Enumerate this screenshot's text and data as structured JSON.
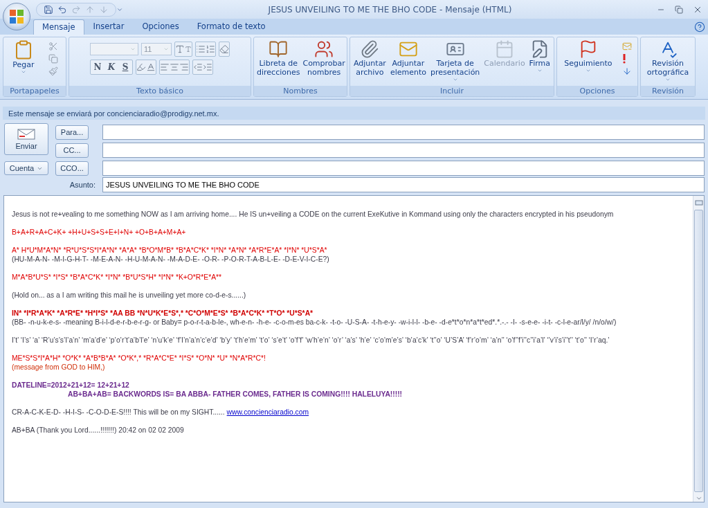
{
  "window": {
    "title": "JESUS UNVEILING TO ME THE BHO CODE - Mensaje (HTML)"
  },
  "ribbon_tabs": [
    {
      "label": "Mensaje",
      "selected": true
    },
    {
      "label": "Insertar",
      "selected": false
    },
    {
      "label": "Opciones",
      "selected": false
    },
    {
      "label": "Formato de texto",
      "selected": false
    }
  ],
  "clipboard": {
    "label": "Portapapeles",
    "paste": "Pegar"
  },
  "basic_text": {
    "label": "Texto básico",
    "font_size": "11",
    "style_buttons": [
      "N",
      "K",
      "S"
    ]
  },
  "groups": [
    {
      "label": "Nombres",
      "buttons": [
        {
          "lines": [
            "Libreta de",
            "direcciones"
          ],
          "menu": false,
          "disabled": false
        },
        {
          "lines": [
            "Comprobar",
            "nombres"
          ],
          "menu": false,
          "disabled": false
        }
      ]
    },
    {
      "label": "Incluir",
      "buttons": [
        {
          "lines": [
            "Adjuntar",
            "archivo"
          ],
          "menu": false,
          "disabled": false
        },
        {
          "lines": [
            "Adjuntar",
            "elemento"
          ],
          "menu": false,
          "disabled": false
        },
        {
          "lines": [
            "Tarjeta de",
            "presentación"
          ],
          "menu": true,
          "disabled": false
        },
        {
          "lines": [
            "Calendario"
          ],
          "menu": false,
          "disabled": true
        },
        {
          "lines": [
            "Firma"
          ],
          "menu": true,
          "disabled": false
        }
      ]
    },
    {
      "label": "Opciones",
      "buttons": [
        {
          "lines": [
            "Seguimiento"
          ],
          "menu": true,
          "disabled": false
        }
      ]
    },
    {
      "label": "Revisión",
      "buttons": [
        {
          "lines": [
            "Revisión",
            "ortográfica"
          ],
          "menu": true,
          "disabled": false
        }
      ]
    }
  ],
  "info_bar": "Este mensaje se enviará por concienciaradio@prodigy.net.mx.",
  "header": {
    "send": "Enviar",
    "account": "Cuenta",
    "recipients": [
      "Para...",
      "CC...",
      "CCO..."
    ],
    "subject_label": "Asunto:",
    "subject": "JESUS UNVEILING TO ME THE BHO CODE"
  },
  "body": [
    [
      {
        "kind": "plain",
        "text": "Jesus is not re+vealing to me something NOW as I am arriving home.... He IS un+veiling a CODE on the current ExeKutive in Kommand using only the characters encrypted in his pseudonym"
      }
    ],
    [
      {
        "kind": "red",
        "text": "B+A+R+A+C+K+ +H+U+S+S+E+I+N+ +O+B+A+M+A+"
      }
    ],
    [
      {
        "kind": "red",
        "text": "A* H*U*M*A*N* *R*U*S*S*I*A*N* *A*A* *B*O*M*B* *B*A*C*K* *I*N* *A*N* *A*R*E*A* *I*N* *U*S*A*"
      },
      {
        "kind": "plain",
        "text": "(HU-M-A-N- -M-I-G-H-T- -M-E-A-N- -H-U-M-A-N- -M-A-D-E- -O-R- -P-O-R-T-A-B-L-E- -D-E-V-I-C-E?)"
      }
    ],
    [
      {
        "kind": "red",
        "text": "M*A*B*U*S* *I*S* *B*A*C*K* *I*N* *B*U*S*H* *I*N* *K+O*R*E*A**"
      }
    ],
    [
      {
        "kind": "plain",
        "text": "(Hold on... as a I am writing this mail he is unveiling yet more co-d-e-s......)"
      }
    ],
    [
      {
        "kind": "strong-red",
        "text": "IN* *I*R*A*K* *A*R*E* *H*I*S* *AA BB *N*U*K*E*S*,* *C*O*M*E*S* *B*A*C*K* *T*O* *U*S*A*"
      },
      {
        "kind": "plain",
        "text": "(BB- -n-u-k-e-s- -meaning B-i-l-d-e-r-b-e-r-g- or Baby= p-o-r-t-a-b-le-, wh-e-n- -h-e- -c-o-m-es ba-c-k- -t-o- -U-S-A- -t-h-e-y- -w-i-l-l- -b-e- -d-e*t*o*n*a*t*ed*.*.-.- -I- -s-e-e- -i-t- -c-l-e-ar/l/y/ /n/o/w/)"
      }
    ],
    [
      {
        "kind": "plain",
        "text": "I’t’ ‘I’s’ ‘a’ ‘R’u’s’s’I’a’n’ ‘m’a’d’e’ ‘p’o’r’t’a’b’l’e’ ‘n’u’k’e’ ‘f’I’n’a’n’c’e’d’ ‘b’y’ ‘t’h’e’m’ ‘t’o’ ‘s’e’t’ ‘o’f’f’ ‘w’h’e’n’ ‘o’r’ ‘a’s’ ‘h’e’ ‘c’o’m’e’s’ ‘b’a’c’k’ ‘t’’o’ ‘U’S’A’ ‘f’r’o’m’ ‘a’n’’ ‘o’f’’f’i’’c’’i’a’l’ ‘’v’i’s’i’’t’’ ‘t’o’’ ‘I’r’aq.’"
      }
    ],
    [
      {
        "kind": "red",
        "text": "ME*S*S*I*A*H* *O*K* *A*B*B*A* *O*K*,* *R*A*C*E* *I*S* *O*N* *U* *N*A*R*C*!"
      },
      {
        "kind": "note",
        "text": "(message from GOD to HIM,)"
      }
    ],
    [
      {
        "kind": "strong-purple",
        "text": "DATELINE=2012+21+12= 12+21+12"
      },
      {
        "kind": "indented-purple",
        "text": "AB+BA+AB= BACKWORDS IS= BA ABBA- FATHER COMES, FATHER IS COMING!!!! HALELUYA!!!!!"
      }
    ],
    [
      {
        "kind": "plain",
        "text": "CR-A-C-K-E-D- -H-I-S- -C-O-D-E-S!!!! This will be on my SIGHT......",
        "link": "www.concienciaradio.com"
      }
    ],
    [
      {
        "kind": "plain",
        "text": "AB+BA (Thank you Lord......!!!!!!!) 20:42 on 02 02 2009"
      }
    ]
  ]
}
